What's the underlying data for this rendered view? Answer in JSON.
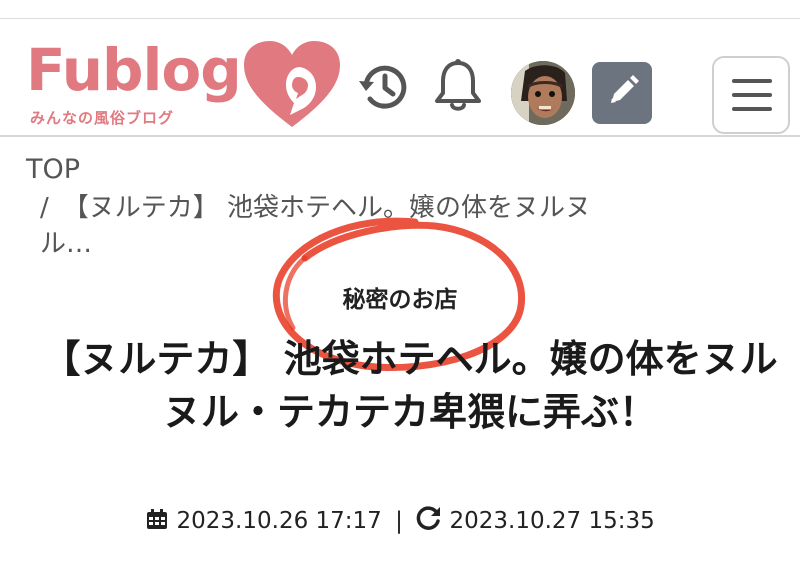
{
  "header": {
    "logo_text": "Fublog",
    "logo_tagline": "みんなの風俗ブログ",
    "brand_color": "#e07a80",
    "icons": [
      "history-icon",
      "bell-icon",
      "edit-icon",
      "menu-icon"
    ]
  },
  "breadcrumb": {
    "top": "TOP",
    "separator": "/",
    "current": "【ヌルテカ】 池袋ホテヘル。嬢の体をヌルヌ\nル…"
  },
  "article": {
    "category": "秘密のお店",
    "title": "【ヌルテカ】 池袋ホテヘル。嬢の体をヌルヌル・テカテカ卑猥に弄ぶ！",
    "posted": "2023.10.26 17:17",
    "separator": "|",
    "updated": "2023.10.27 15:35"
  },
  "annotation_color": "#e8361e"
}
